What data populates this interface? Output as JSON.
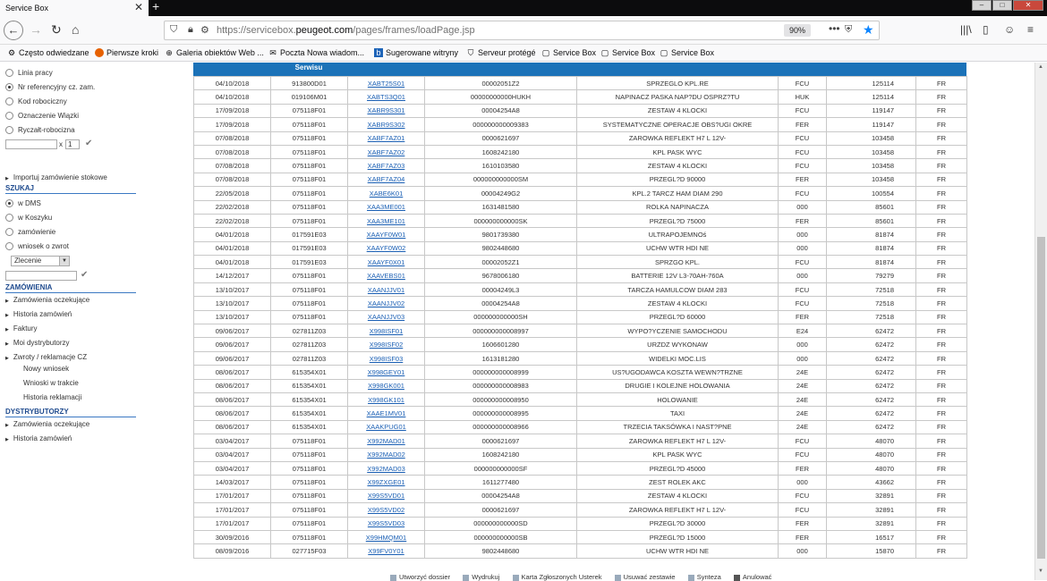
{
  "browser": {
    "tab_title": "Service Box",
    "url_prefix": "https://servicebox.",
    "url_domain": "peugeot.com",
    "url_path": "/pages/frames/loadPage.jsp",
    "zoom": "90%",
    "bookmarks": [
      "Często odwiedzane",
      "Pierwsze kroki",
      "Galeria obiektów Web ...",
      "Poczta Nowa wiadom...",
      "Sugerowane witryny",
      "Serveur protégé",
      "Service Box",
      "Service Box",
      "Service Box"
    ]
  },
  "sidebar": {
    "search_options": [
      "Linia pracy",
      "Nr referencyjny cz. zam.",
      "Kod robociczny",
      "Oznaczenie Wiązki",
      "Ryczałt-robocizna"
    ],
    "search_selected": 1,
    "qty_label": "x",
    "qty_value": "1",
    "import_label": "Importuj zamówienie stokowe",
    "szukaj_title": "SZUKAJ",
    "szukaj_options": [
      "w DMS",
      "w Koszyku",
      "zamówienie",
      "wniosek o zwrot"
    ],
    "szukaj_selected": 0,
    "select_value": "Zlecenie",
    "zamowienia_title": "ZAMÓWIENIA",
    "zamowienia_links": [
      "Zamówienia oczekujące",
      "Historia zamówień",
      "Faktury",
      "Moi dystrybutorzy",
      "Zwroty / reklamacje CZ"
    ],
    "zwroty_sub": [
      "Nowy wniosek",
      "Wnioski w trakcie",
      "Historia reklamacji"
    ],
    "dystrybutorzy_title": "DYSTRYBUTORZY",
    "dystrybutorzy_links": [
      "Zamówienia oczekujące",
      "Historia zamówień"
    ]
  },
  "table": {
    "header_visible": "Serwisu",
    "rows": [
      [
        "04/10/2018",
        "913800D01",
        "XABT25S01",
        "00002051Z2",
        "SPRZEGLO KPL.RE",
        "FCU",
        "125114",
        "FR"
      ],
      [
        "04/10/2018",
        "019106M01",
        "XABTS3Q01",
        "00000000000HUKH",
        "NAPINACZ PASKA NAP?DU OSPRZ?TU",
        "HUK",
        "125114",
        "FR"
      ],
      [
        "17/09/2018",
        "075118F01",
        "XABR9S301",
        "00004254A8",
        "ZESTAW 4 KLOCKI",
        "FCU",
        "119147",
        "FR"
      ],
      [
        "17/09/2018",
        "075118F01",
        "XABR9S302",
        "000000000009383",
        "SYSTEMATYCZNE OPERACJE OBS?UGI OKRE",
        "FER",
        "119147",
        "FR"
      ],
      [
        "07/08/2018",
        "075118F01",
        "XABF7AZ01",
        "0000621697",
        "ZAROWKA REFLEKT H7 L 12V-",
        "FCU",
        "103458",
        "FR"
      ],
      [
        "07/08/2018",
        "075118F01",
        "XABF7AZ02",
        "1608242180",
        "KPL PASK WYC",
        "FCU",
        "103458",
        "FR"
      ],
      [
        "07/08/2018",
        "075118F01",
        "XABF7AZ03",
        "1610103580",
        "ZESTAW 4 KLOCKI",
        "FCU",
        "103458",
        "FR"
      ],
      [
        "07/08/2018",
        "075118F01",
        "XABF7AZ04",
        "000000000000SM",
        "PRZEGL?D 90000",
        "FER",
        "103458",
        "FR"
      ],
      [
        "22/05/2018",
        "075118F01",
        "XABE6K01",
        "00004249G2",
        "KPL.2 TARCZ HAM DIAM 290",
        "FCU",
        "100554",
        "FR"
      ],
      [
        "22/02/2018",
        "075118F01",
        "XAA3ME001",
        "1631481580",
        "ROLKA NAPINACZA",
        "000",
        "85601",
        "FR"
      ],
      [
        "22/02/2018",
        "075118F01",
        "XAA3ME101",
        "000000000000SK",
        "PRZEGL?D 75000",
        "FER",
        "85601",
        "FR"
      ],
      [
        "04/01/2018",
        "017591E03",
        "XAAYF0W01",
        "9801739380",
        "ULTRAPOJEMNOś",
        "000",
        "81874",
        "FR"
      ],
      [
        "04/01/2018",
        "017591E03",
        "XAAYF0W02",
        "9802448680",
        "UCHW WTR HDI NE",
        "000",
        "81874",
        "FR"
      ],
      [
        "04/01/2018",
        "017591E03",
        "XAAYF0X01",
        "00002052Z1",
        "SPRZGO KPL.",
        "FCU",
        "81874",
        "FR"
      ],
      [
        "14/12/2017",
        "075118F01",
        "XAAVEBS01",
        "9678006180",
        "BATTERIE 12V L3-70AH-760A",
        "000",
        "79279",
        "FR"
      ],
      [
        "13/10/2017",
        "075118F01",
        "XAANJJV01",
        "00004249L3",
        "TARCZA HAMULCOW DIAM 283",
        "FCU",
        "72518",
        "FR"
      ],
      [
        "13/10/2017",
        "075118F01",
        "XAANJJV02",
        "00004254A8",
        "ZESTAW 4 KLOCKI",
        "FCU",
        "72518",
        "FR"
      ],
      [
        "13/10/2017",
        "075118F01",
        "XAANJJV03",
        "000000000000SH",
        "PRZEGL?D 60000",
        "FER",
        "72518",
        "FR"
      ],
      [
        "09/06/2017",
        "027811Z03",
        "X998ISF01",
        "000000000008997",
        "WYPO?YCZENIE SAMOCHODU",
        "E24",
        "62472",
        "FR"
      ],
      [
        "09/06/2017",
        "027811Z03",
        "X998ISF02",
        "1606601280",
        "URZDZ WYKONAW",
        "000",
        "62472",
        "FR"
      ],
      [
        "09/06/2017",
        "027811Z03",
        "X998ISF03",
        "1613181280",
        "WIDELKI MOC.LIS",
        "000",
        "62472",
        "FR"
      ],
      [
        "08/06/2017",
        "615354X01",
        "X998GEY01",
        "000000000008999",
        "US?UGODAWCA KOSZTA WEWN?TRZNE",
        "24E",
        "62472",
        "FR"
      ],
      [
        "08/06/2017",
        "615354X01",
        "X998GK001",
        "000000000008983",
        "DRUGIE I KOLEJNE HOLOWANIA",
        "24E",
        "62472",
        "FR"
      ],
      [
        "08/06/2017",
        "615354X01",
        "X998GK101",
        "000000000008950",
        "HOLOWANIE",
        "24E",
        "62472",
        "FR"
      ],
      [
        "08/06/2017",
        "615354X01",
        "XAAE1MV01",
        "000000000008995",
        "TAXI",
        "24E",
        "62472",
        "FR"
      ],
      [
        "08/06/2017",
        "615354X01",
        "XAAKPUG01",
        "000000000008966",
        "TRZECIA TAKSÓWKA I NAST?PNE",
        "24E",
        "62472",
        "FR"
      ],
      [
        "03/04/2017",
        "075118F01",
        "X992MAD01",
        "0000621697",
        "ZAROWKA REFLEKT H7 L 12V-",
        "FCU",
        "48070",
        "FR"
      ],
      [
        "03/04/2017",
        "075118F01",
        "X992MAD02",
        "1608242180",
        "KPL PASK WYC",
        "FCU",
        "48070",
        "FR"
      ],
      [
        "03/04/2017",
        "075118F01",
        "X992MAD03",
        "000000000000SF",
        "PRZEGL?D 45000",
        "FER",
        "48070",
        "FR"
      ],
      [
        "14/03/2017",
        "075118F01",
        "X99ZXGE01",
        "1611277480",
        "ZEST ROLEK AKC",
        "000",
        "43662",
        "FR"
      ],
      [
        "17/01/2017",
        "075118F01",
        "X99S5VD01",
        "00004254A8",
        "ZESTAW 4 KLOCKI",
        "FCU",
        "32891",
        "FR"
      ],
      [
        "17/01/2017",
        "075118F01",
        "X99S5VD02",
        "0000621697",
        "ZAROWKA REFLEKT H7 L 12V-",
        "FCU",
        "32891",
        "FR"
      ],
      [
        "17/01/2017",
        "075118F01",
        "X99S5VD03",
        "000000000000SD",
        "PRZEGL?D 30000",
        "FER",
        "32891",
        "FR"
      ],
      [
        "30/09/2016",
        "075118F01",
        "X99HMQM01",
        "000000000000SB",
        "PRZEGL?D 15000",
        "FER",
        "16517",
        "FR"
      ],
      [
        "08/09/2016",
        "027715F03",
        "X99FV0Y01",
        "9802448680",
        "UCHW WTR HDI NE",
        "000",
        "15870",
        "FR"
      ]
    ]
  },
  "footer": [
    "Utworzyć dossier",
    "Wydrukuj",
    "Karta Zgłoszonych Usterek",
    "Usuwać zestawie",
    "Synteza",
    "Anulować"
  ]
}
